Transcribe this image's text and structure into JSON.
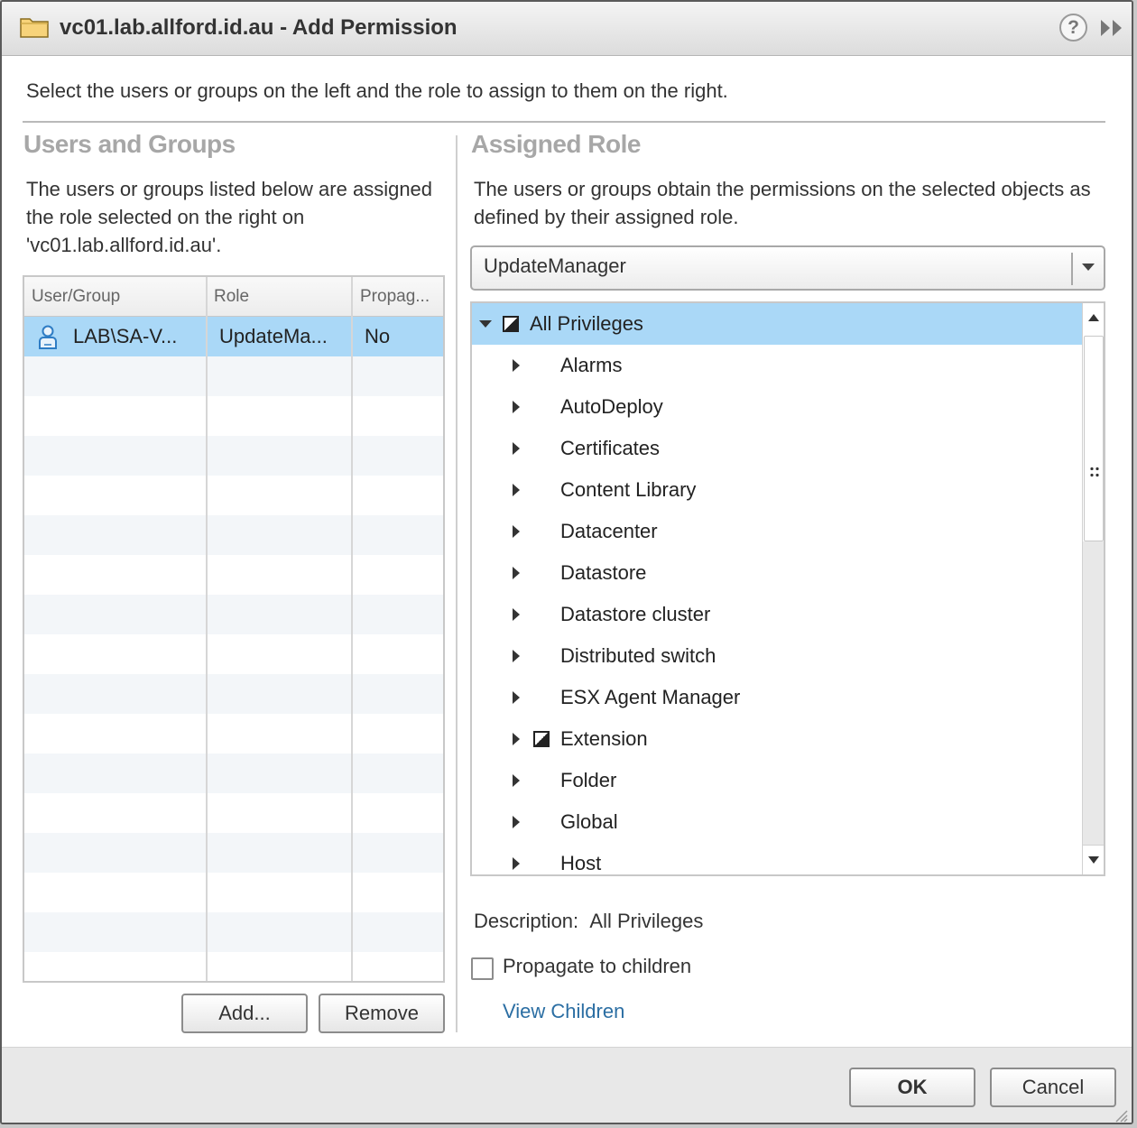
{
  "window": {
    "title": "vc01.lab.allford.id.au - Add Permission",
    "help_label": "?"
  },
  "intro": "Select the users or groups on the left and the role to assign to them on the right.",
  "users_groups": {
    "title": "Users and Groups",
    "description": "The users or groups listed below are assigned the role selected on the right on 'vc01.lab.allford.id.au'.",
    "columns": [
      "User/Group",
      "Role",
      "Propag..."
    ],
    "rows": [
      {
        "user": "LAB\\SA-V...",
        "role": "UpdateMa...",
        "propagate": "No"
      }
    ],
    "add_label": "Add...",
    "remove_label": "Remove"
  },
  "assigned_role": {
    "title": "Assigned Role",
    "description": "The users or groups obtain the permissions on the selected objects as defined by their assigned role.",
    "selected_role": "UpdateManager",
    "tree": {
      "root": "All Privileges",
      "children": [
        "Alarms",
        "AutoDeploy",
        "Certificates",
        "Content Library",
        "Datacenter",
        "Datastore",
        "Datastore cluster",
        "Distributed switch",
        "ESX Agent Manager",
        "Extension",
        "Folder",
        "Global",
        "Host"
      ]
    },
    "description_label": "Description:",
    "description_value": "All Privileges",
    "propagate_label": "Propagate to children",
    "view_children_label": "View Children"
  },
  "footer": {
    "ok_label": "OK",
    "cancel_label": "Cancel"
  },
  "colors": {
    "selection": "#aad8f7",
    "link": "#2b6ea3",
    "section_title": "#a7a7a7"
  }
}
